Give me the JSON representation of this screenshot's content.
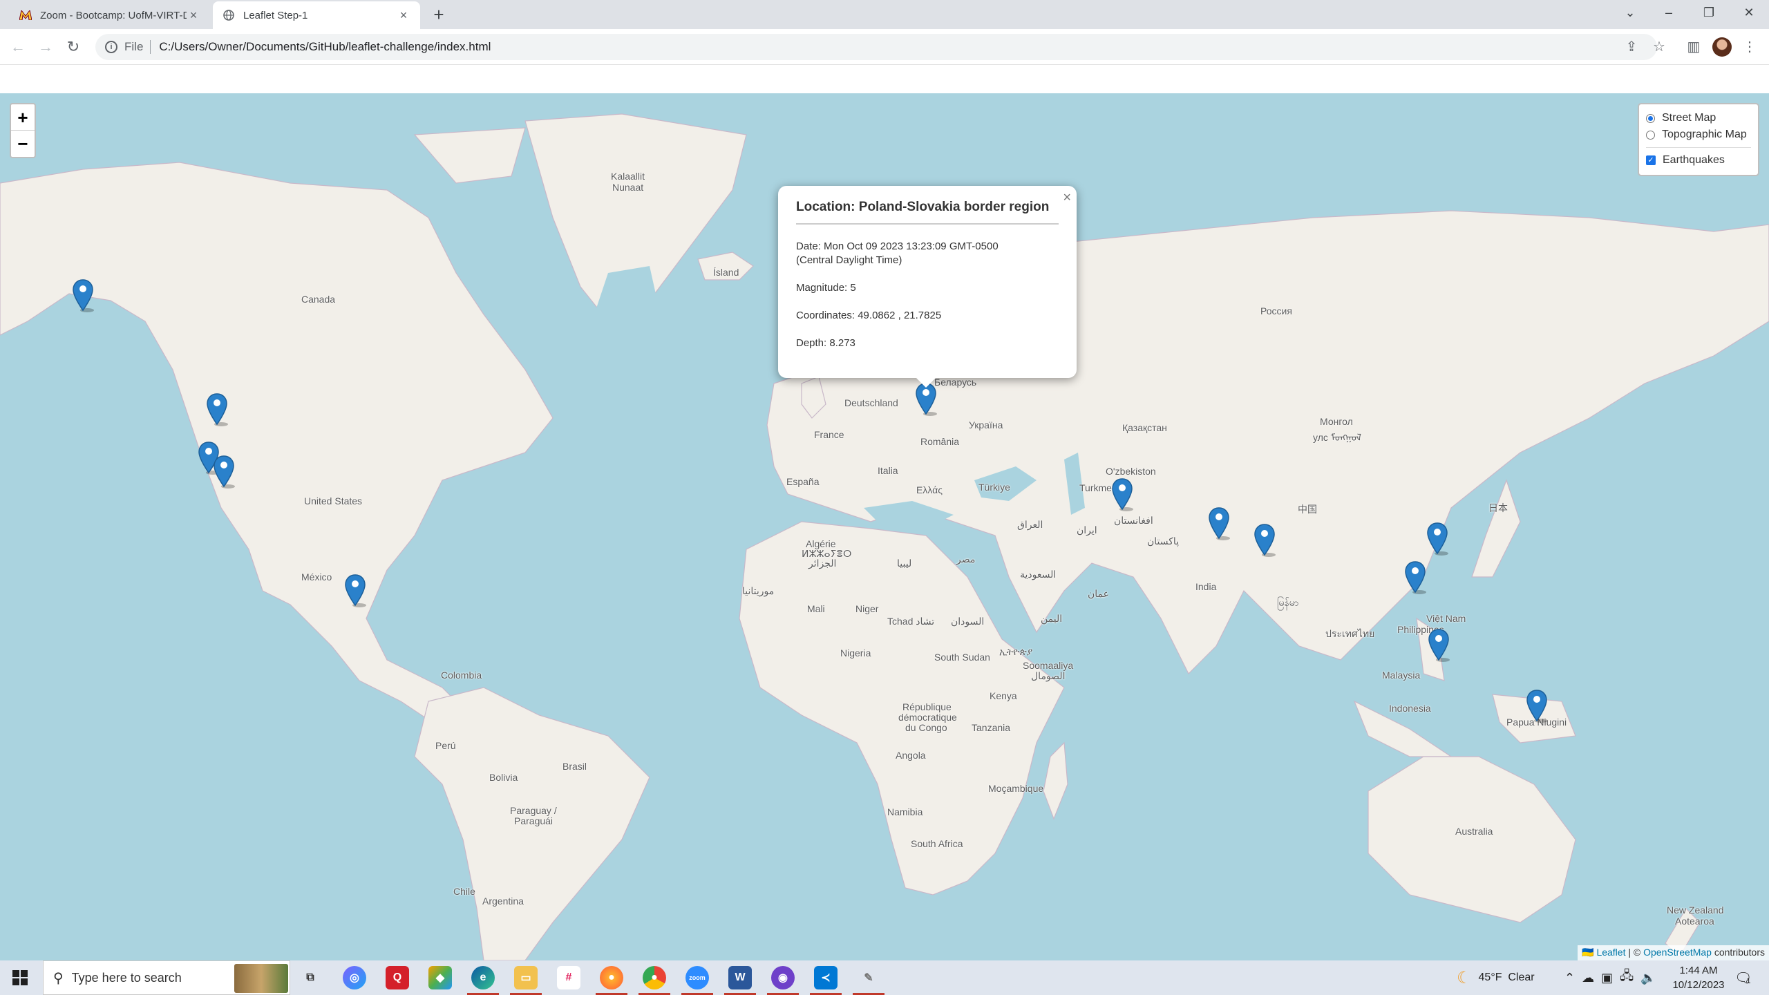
{
  "browser": {
    "tabs": [
      {
        "title": "Zoom - Bootcamp: UofM-VIRT-D",
        "active": false,
        "icon": "zoom-m-icon"
      },
      {
        "title": "Leaflet Step-1",
        "active": true,
        "icon": "globe-icon"
      }
    ],
    "address_prefix": "File",
    "url": "C:/Users/Owner/Documents/GitHub/leaflet-challenge/index.html"
  },
  "map": {
    "zoom_in": "+",
    "zoom_out": "−",
    "layers": {
      "base": [
        {
          "label": "Street Map",
          "selected": true
        },
        {
          "label": "Topographic Map",
          "selected": false
        }
      ],
      "overlays": [
        {
          "label": "Earthquakes",
          "checked": true
        }
      ]
    },
    "popup": {
      "close": "×",
      "title": "Location: Poland-Slovakia border region",
      "date_line1": "Date: Mon Oct 09 2023 13:23:09 GMT-0500",
      "date_line2": "(Central Daylight Time)",
      "magnitude": "Magnitude: 5",
      "coordinates": "Coordinates: 49.0862 , 21.7825",
      "depth": "Depth: 8.273"
    },
    "labels": {
      "kalaallit": "Kalaallit",
      "nunaat": "Nunaat",
      "island": "Ísland",
      "canada": "Canada",
      "united_states": "United States",
      "mexico": "México",
      "colombia": "Colombia",
      "peru": "Perú",
      "brasil": "Brasil",
      "bolivia": "Bolivia",
      "paraguay": "Paraguay /",
      "paraguay2": "Paraguái",
      "chile": "Chile",
      "argentina": "Argentina",
      "rossiya": "Россия",
      "deutschland": "Deutschland",
      "belarus": "Беларусь",
      "ukraina": "Україна",
      "france": "France",
      "espana": "España",
      "italia": "Italia",
      "romania": "România",
      "turkiye": "Türkiye",
      "ellas": "Ελλάς",
      "kazakhstan": "Қазақстан",
      "mongol": "Монгол",
      "mongol2": "улс ᠮᠣᠩᠭᠣᠯ",
      "uzbekiston": "O'zbekiston",
      "turkmenistan": "Turkmen",
      "china": "中国",
      "nihon": "日本",
      "iraq": "العراق",
      "iran": "ایران",
      "afghanistan": "افغانستان",
      "pakistan": "پاکستان",
      "india": "India",
      "saudi": "السعودية",
      "oman": "عمان",
      "yemen": "اليمن",
      "misr": "مصر",
      "libya": "ليبيا",
      "algerie": "Algérie",
      "algerie2": "ⵍⵣⵣⴰⵢⴻⵔ",
      "algerie3": "الجزائر",
      "mauritania": "موريتانيا",
      "mali": "Mali",
      "niger": "Niger",
      "tchad": "Tchad تشاد",
      "sudan": "السودان",
      "nigeria": "Nigeria",
      "south_sudan": "South Sudan",
      "ethiopia": "ኢትዮጵያ",
      "somalia": "Soomaaliya",
      "somalia2": "الصومال",
      "drc": "République",
      "drc2": "démocratique",
      "drc3": "du Congo",
      "kenya": "Kenya",
      "tanzania": "Tanzania",
      "angola": "Angola",
      "mocambique": "Moçambique",
      "namibia": "Namibia",
      "south_africa": "South Africa",
      "vietnam": "Việt Nam",
      "myanmar": "မြန်မာ",
      "thailand": "ประเทศไทย",
      "philippines": "Philippines",
      "malaysia": "Malaysia",
      "indonesia": "Indonesia",
      "png": "Papua Niugini",
      "australia": "Australia",
      "nz": "New Zealand",
      "nz2": "Aotearoa"
    },
    "attribution": {
      "leaflet": "Leaflet",
      "sep": " | © ",
      "osm": "OpenStreetMap",
      "suffix": " contributors"
    }
  },
  "taskbar": {
    "search_placeholder": "Type here to search",
    "apps": [
      "task-view-icon",
      "copilot-icon",
      "quip-icon",
      "git-app-icon",
      "edge-icon",
      "file-explorer-icon",
      "slack-icon",
      "firefox-icon",
      "chrome-icon",
      "zoom-icon",
      "word-icon",
      "github-desktop-icon",
      "vscode-icon",
      "paint-icon"
    ],
    "weather": "45°F  Clear",
    "time": "1:44 AM",
    "date": "10/12/2023",
    "notifications": "1"
  }
}
